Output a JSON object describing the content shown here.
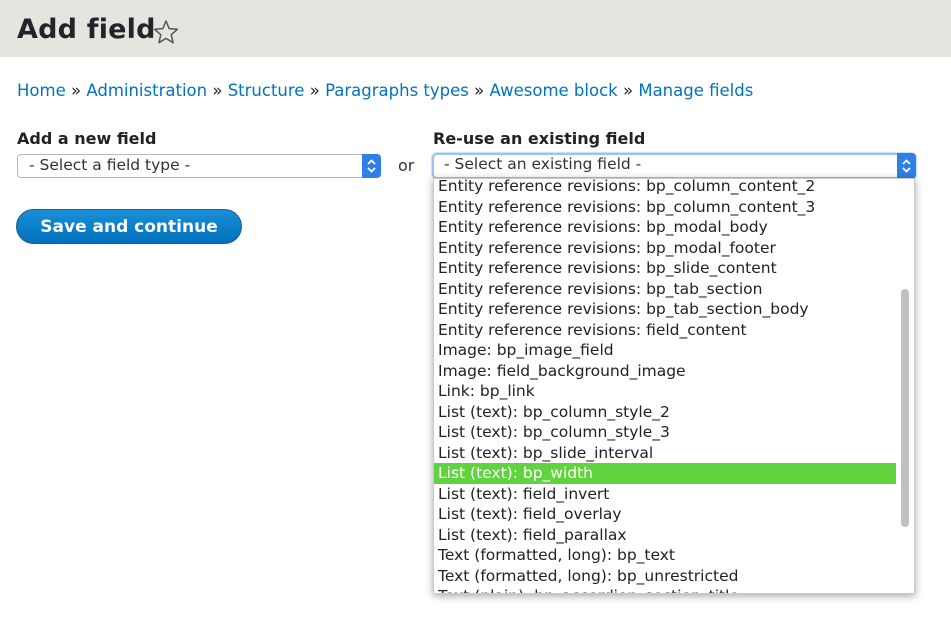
{
  "header": {
    "title": "Add field",
    "favorite_icon": "star-outline-icon"
  },
  "breadcrumb": {
    "items": [
      "Home",
      "Administration",
      "Structure",
      "Paragraphs types",
      "Awesome block",
      "Manage fields"
    ],
    "separator": "»"
  },
  "new_field": {
    "label": "Add a new field",
    "selected": "- Select a field type -"
  },
  "or_label": "or",
  "existing_field": {
    "label": "Re-use an existing field",
    "selected": "- Select an existing field -",
    "options": [
      "Entity reference revisions: bp_column_content_2",
      "Entity reference revisions: bp_column_content_3",
      "Entity reference revisions: bp_modal_body",
      "Entity reference revisions: bp_modal_footer",
      "Entity reference revisions: bp_slide_content",
      "Entity reference revisions: bp_tab_section",
      "Entity reference revisions: bp_tab_section_body",
      "Entity reference revisions: field_content",
      "Image: bp_image_field",
      "Image: field_background_image",
      "Link: bp_link",
      "List (text): bp_column_style_2",
      "List (text): bp_column_style_3",
      "List (text): bp_slide_interval",
      "List (text): bp_width",
      "List (text): field_invert",
      "List (text): field_overlay",
      "List (text): field_parallax",
      "Text (formatted, long): bp_text",
      "Text (formatted, long): bp_unrestricted",
      "Text (plain): bp_accordion_section_title"
    ],
    "highlighted": "List (text): bp_width"
  },
  "save_button": {
    "label": "Save and continue"
  },
  "colors": {
    "link": "#0074bd",
    "header_bg": "#e6e4df",
    "button": "#0071bb",
    "highlight": "#60d33e",
    "select_arrow": "#2f7fe6"
  }
}
